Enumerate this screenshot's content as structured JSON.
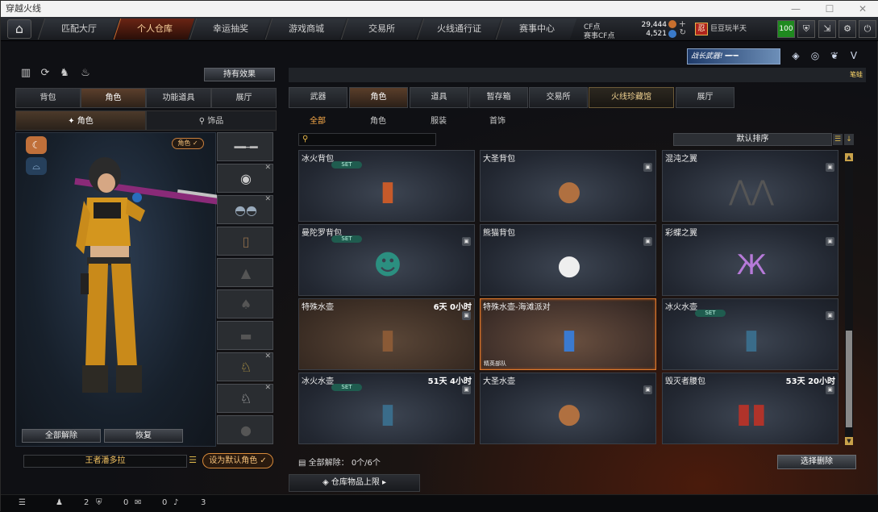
{
  "window": {
    "title": "穿越火线"
  },
  "topnav": {
    "tabs": [
      "匹配大厅",
      "个人仓库",
      "幸运抽奖",
      "游戏商城",
      "交易所",
      "火线通行证",
      "赛事中心"
    ],
    "active_index": 1
  },
  "currency": {
    "cf_label": "CF点",
    "cf_value": "29,444",
    "event_cf_label": "赛事CF点",
    "event_cf_value": "4,521"
  },
  "user": {
    "name": "巨豆玩半天",
    "level": "100"
  },
  "left": {
    "effect_button": "持有效果",
    "tabs": [
      "背包",
      "角色",
      "功能道具",
      "展厅"
    ],
    "active_tab": 1,
    "subtabs": [
      "角色",
      "饰品"
    ],
    "active_subtab": 0,
    "role_badge": "角色",
    "unequip_all": "全部解除",
    "restore": "恢复",
    "character_name": "王者潘多拉",
    "set_default": "设为默认角色"
  },
  "right": {
    "banner": "战长武器!",
    "corner_label": "笔蛙",
    "tabs": [
      "武器",
      "角色",
      "道具",
      "暂存箱",
      "交易所",
      "火线珍藏馆",
      "展厅"
    ],
    "active_tab": 1,
    "subtabs": [
      "全部",
      "角色",
      "服装",
      "首饰"
    ],
    "active_subtab": 0,
    "sort_label": "默认排序",
    "items": [
      {
        "name": "冰火背包",
        "set": "SET",
        "time": "",
        "tag": "",
        "icon": "🔥"
      },
      {
        "name": "大圣背包",
        "set": "",
        "time": "",
        "tag": "",
        "icon": "🐵"
      },
      {
        "name": "混沌之翼",
        "set": "",
        "time": "",
        "tag": "",
        "icon": "🦇"
      },
      {
        "name": "曼陀罗背包",
        "set": "SET",
        "time": "",
        "tag": "",
        "icon": "🎒"
      },
      {
        "name": "熊猫背包",
        "set": "",
        "time": "",
        "tag": "",
        "icon": "🐼"
      },
      {
        "name": "彩蝶之翼",
        "set": "",
        "time": "",
        "tag": "",
        "icon": "🦋"
      },
      {
        "name": "特殊水壶",
        "set": "",
        "time": "6天 0小时",
        "tag": "",
        "icon": "🧴"
      },
      {
        "name": "特殊水壶-海滩派对",
        "set": "",
        "time": "",
        "tag": "精英部队",
        "icon": "🧃"
      },
      {
        "name": "冰火水壶",
        "set": "SET",
        "time": "",
        "tag": "",
        "icon": "🧊"
      },
      {
        "name": "冰火水壶",
        "set": "SET",
        "time": "51天 4小时",
        "tag": "",
        "icon": "🧊"
      },
      {
        "name": "大圣水壶",
        "set": "",
        "time": "",
        "tag": "",
        "icon": "🍶"
      },
      {
        "name": "毁灭者腰包",
        "set": "",
        "time": "53天 20小时",
        "tag": "",
        "icon": "🧯"
      }
    ],
    "unequip_status": "全部解除：  0个/6个",
    "delete_selected": "选择删除",
    "capacity": "仓库物品上限"
  },
  "statusbar": {
    "count1": "2",
    "count2": "0",
    "count3": "0",
    "count4": "3"
  }
}
